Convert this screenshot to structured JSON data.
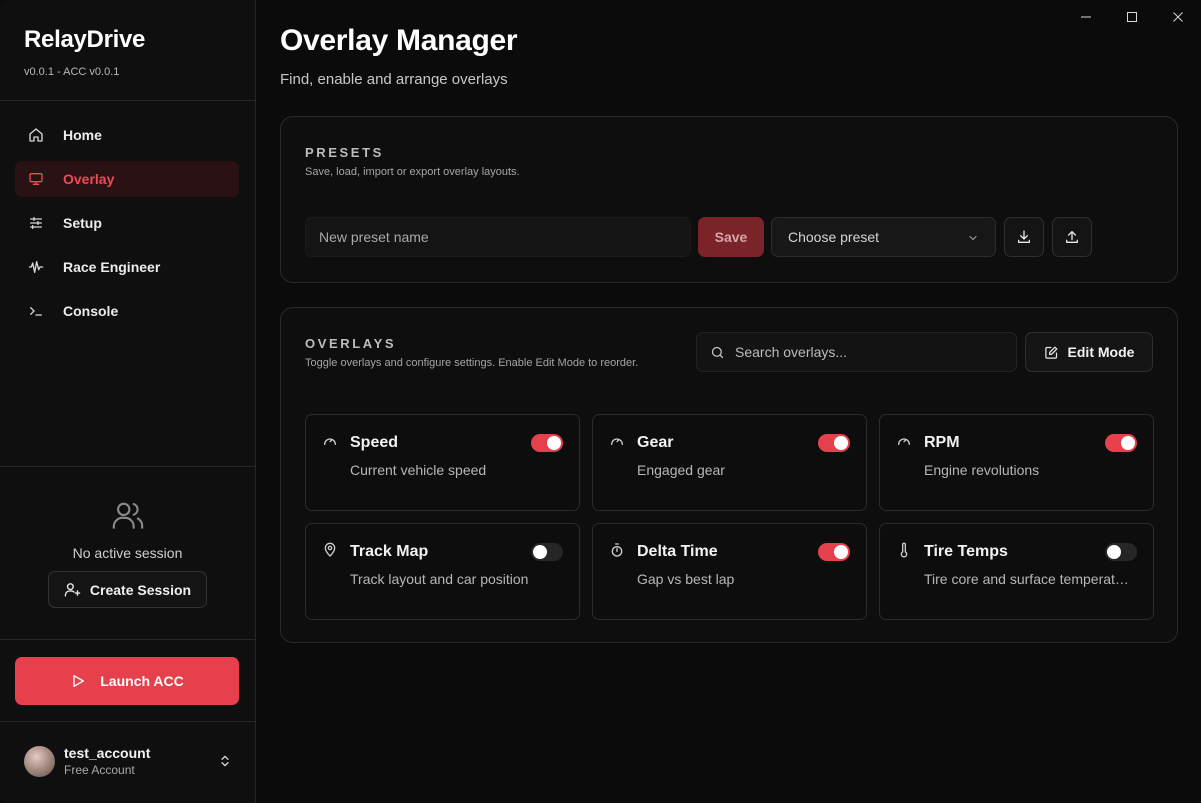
{
  "app": {
    "name": "RelayDrive",
    "version": "v0.0.1 - ACC v0.0.1"
  },
  "colors": {
    "accent": "#e5404c",
    "active_nav_bg": "#2a1214",
    "background": "#0b0b0b"
  },
  "sidebar": {
    "items": [
      {
        "label": "Home",
        "icon": "home-icon",
        "active": false
      },
      {
        "label": "Overlay",
        "icon": "monitor-icon",
        "active": true
      },
      {
        "label": "Setup",
        "icon": "sliders-icon",
        "active": false
      },
      {
        "label": "Race Engineer",
        "icon": "waveform-icon",
        "active": false
      },
      {
        "label": "Console",
        "icon": "terminal-icon",
        "active": false
      }
    ],
    "session": {
      "status": "No active session",
      "create_label": "Create Session"
    },
    "launch_label": "Launch ACC",
    "account": {
      "name": "test_account",
      "plan": "Free Account"
    }
  },
  "header": {
    "title": "Overlay Manager",
    "subtitle": "Find, enable and arrange overlays"
  },
  "presets": {
    "heading": "PRESETS",
    "description": "Save, load, import or export overlay layouts.",
    "input_placeholder": "New preset name",
    "save_label": "Save",
    "select_value": "Choose preset"
  },
  "overlays": {
    "heading": "OVERLAYS",
    "description": "Toggle overlays and configure settings. Enable Edit Mode to reorder.",
    "search_placeholder": "Search overlays...",
    "edit_label": "Edit Mode",
    "items": [
      {
        "title": "Speed",
        "desc": "Current vehicle speed",
        "icon": "gauge-icon",
        "enabled": true
      },
      {
        "title": "Gear",
        "desc": "Engaged gear",
        "icon": "gauge-icon",
        "enabled": true
      },
      {
        "title": "RPM",
        "desc": "Engine revolutions",
        "icon": "gauge-icon",
        "enabled": true
      },
      {
        "title": "Track Map",
        "desc": "Track layout and car position",
        "icon": "map-pin-icon",
        "enabled": false
      },
      {
        "title": "Delta Time",
        "desc": "Gap vs best lap",
        "icon": "stopwatch-icon",
        "enabled": true
      },
      {
        "title": "Tire Temps",
        "desc": "Tire core and surface temperatures",
        "icon": "thermometer-icon",
        "enabled": false
      }
    ]
  }
}
